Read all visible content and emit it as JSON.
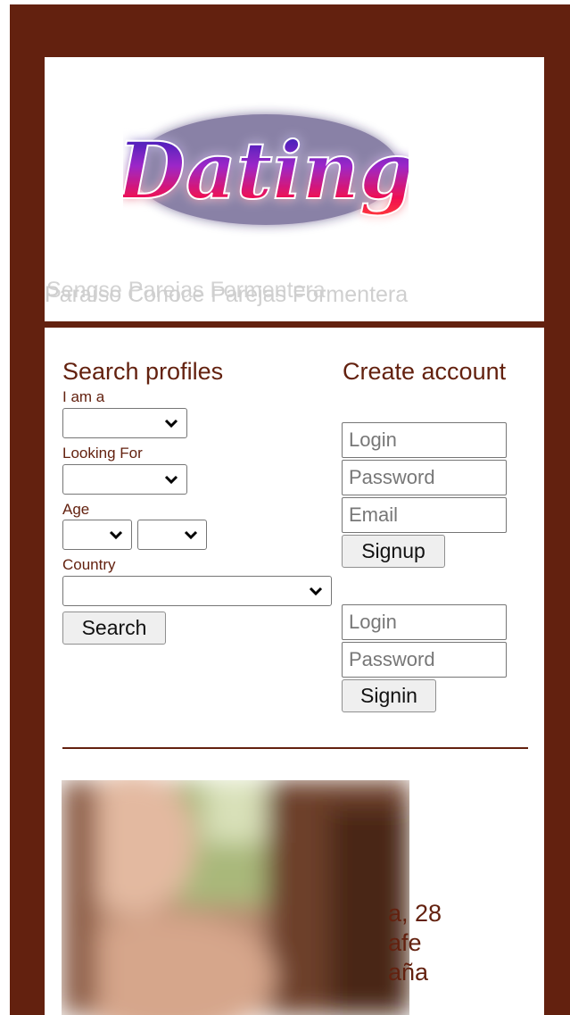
{
  "header": {
    "logo_text": "Dating",
    "tagline_back": "Sengse Parejas Formentera",
    "tagline_front": "Paraíso Conoce Parejas Formentera"
  },
  "search": {
    "title": "Search profiles",
    "i_am_label": "I am a",
    "looking_for_label": "Looking For",
    "age_label": "Age",
    "country_label": "Country",
    "search_button": "Search"
  },
  "create_account": {
    "title": "Create account",
    "login_placeholder": "Login",
    "password_placeholder": "Password",
    "email_placeholder": "Email",
    "signup_button": "Signup"
  },
  "signin": {
    "login_placeholder": "Login",
    "password_placeholder": "Password",
    "signin_button": "Signin"
  },
  "profile": {
    "line1": "a, 28",
    "line2": "afe",
    "line3": "aña"
  },
  "colors": {
    "brand": "#63210f",
    "panel": "#ffffff"
  }
}
